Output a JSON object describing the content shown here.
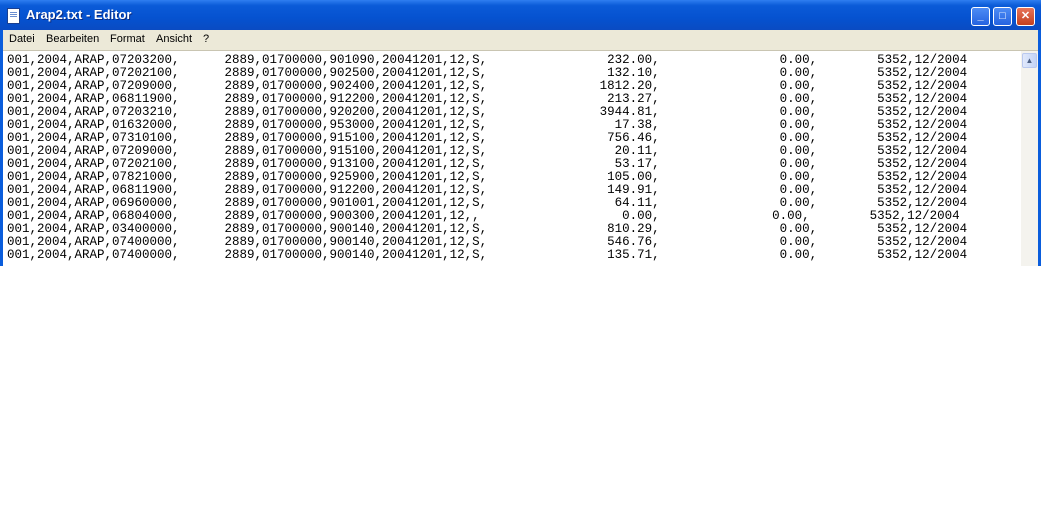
{
  "window": {
    "title": "Arap2.txt - Editor"
  },
  "menu": {
    "items": [
      "Datei",
      "Bearbeiten",
      "Format",
      "Ansicht",
      "?"
    ]
  },
  "editor": {
    "lines": [
      "001,2004,ARAP,07203200,      2889,01700000,901090,20041201,12,S,                232.00,                0.00,        5352,12/2004",
      "001,2004,ARAP,07202100,      2889,01700000,902500,20041201,12,S,                132.10,                0.00,        5352,12/2004",
      "001,2004,ARAP,07209000,      2889,01700000,902400,20041201,12,S,               1812.20,                0.00,        5352,12/2004",
      "001,2004,ARAP,06811900,      2889,01700000,912200,20041201,12,S,                213.27,                0.00,        5352,12/2004",
      "001,2004,ARAP,07203210,      2889,01700000,920200,20041201,12,S,               3944.81,                0.00,        5352,12/2004",
      "001,2004,ARAP,01632000,      2889,01700000,953000,20041201,12,S,                 17.38,                0.00,        5352,12/2004",
      "001,2004,ARAP,07310100,      2889,01700000,915100,20041201,12,S,                756.46,                0.00,        5352,12/2004",
      "001,2004,ARAP,07209000,      2889,01700000,915100,20041201,12,S,                 20.11,                0.00,        5352,12/2004",
      "001,2004,ARAP,07202100,      2889,01700000,913100,20041201,12,S,                 53.17,                0.00,        5352,12/2004",
      "001,2004,ARAP,07821000,      2889,01700000,925900,20041201,12,S,                105.00,                0.00,        5352,12/2004",
      "001,2004,ARAP,06811900,      2889,01700000,912200,20041201,12,S,                149.91,                0.00,        5352,12/2004",
      "001,2004,ARAP,06960000,      2889,01700000,901001,20041201,12,S,                 64.11,                0.00,        5352,12/2004",
      "001,2004,ARAP,06804000,      2889,01700000,900300,20041201,12,,                   0.00,               0.00,        5352,12/2004",
      "001,2004,ARAP,03400000,      2889,01700000,900140,20041201,12,S,                810.29,                0.00,        5352,12/2004",
      "001,2004,ARAP,07400000,      2889,01700000,900140,20041201,12,S,                546.76,                0.00,        5352,12/2004",
      "001,2004,ARAP,07400000,      2889,01700000,900140,20041201,12,S,                135.71,                0.00,        5352,12/2004"
    ]
  }
}
